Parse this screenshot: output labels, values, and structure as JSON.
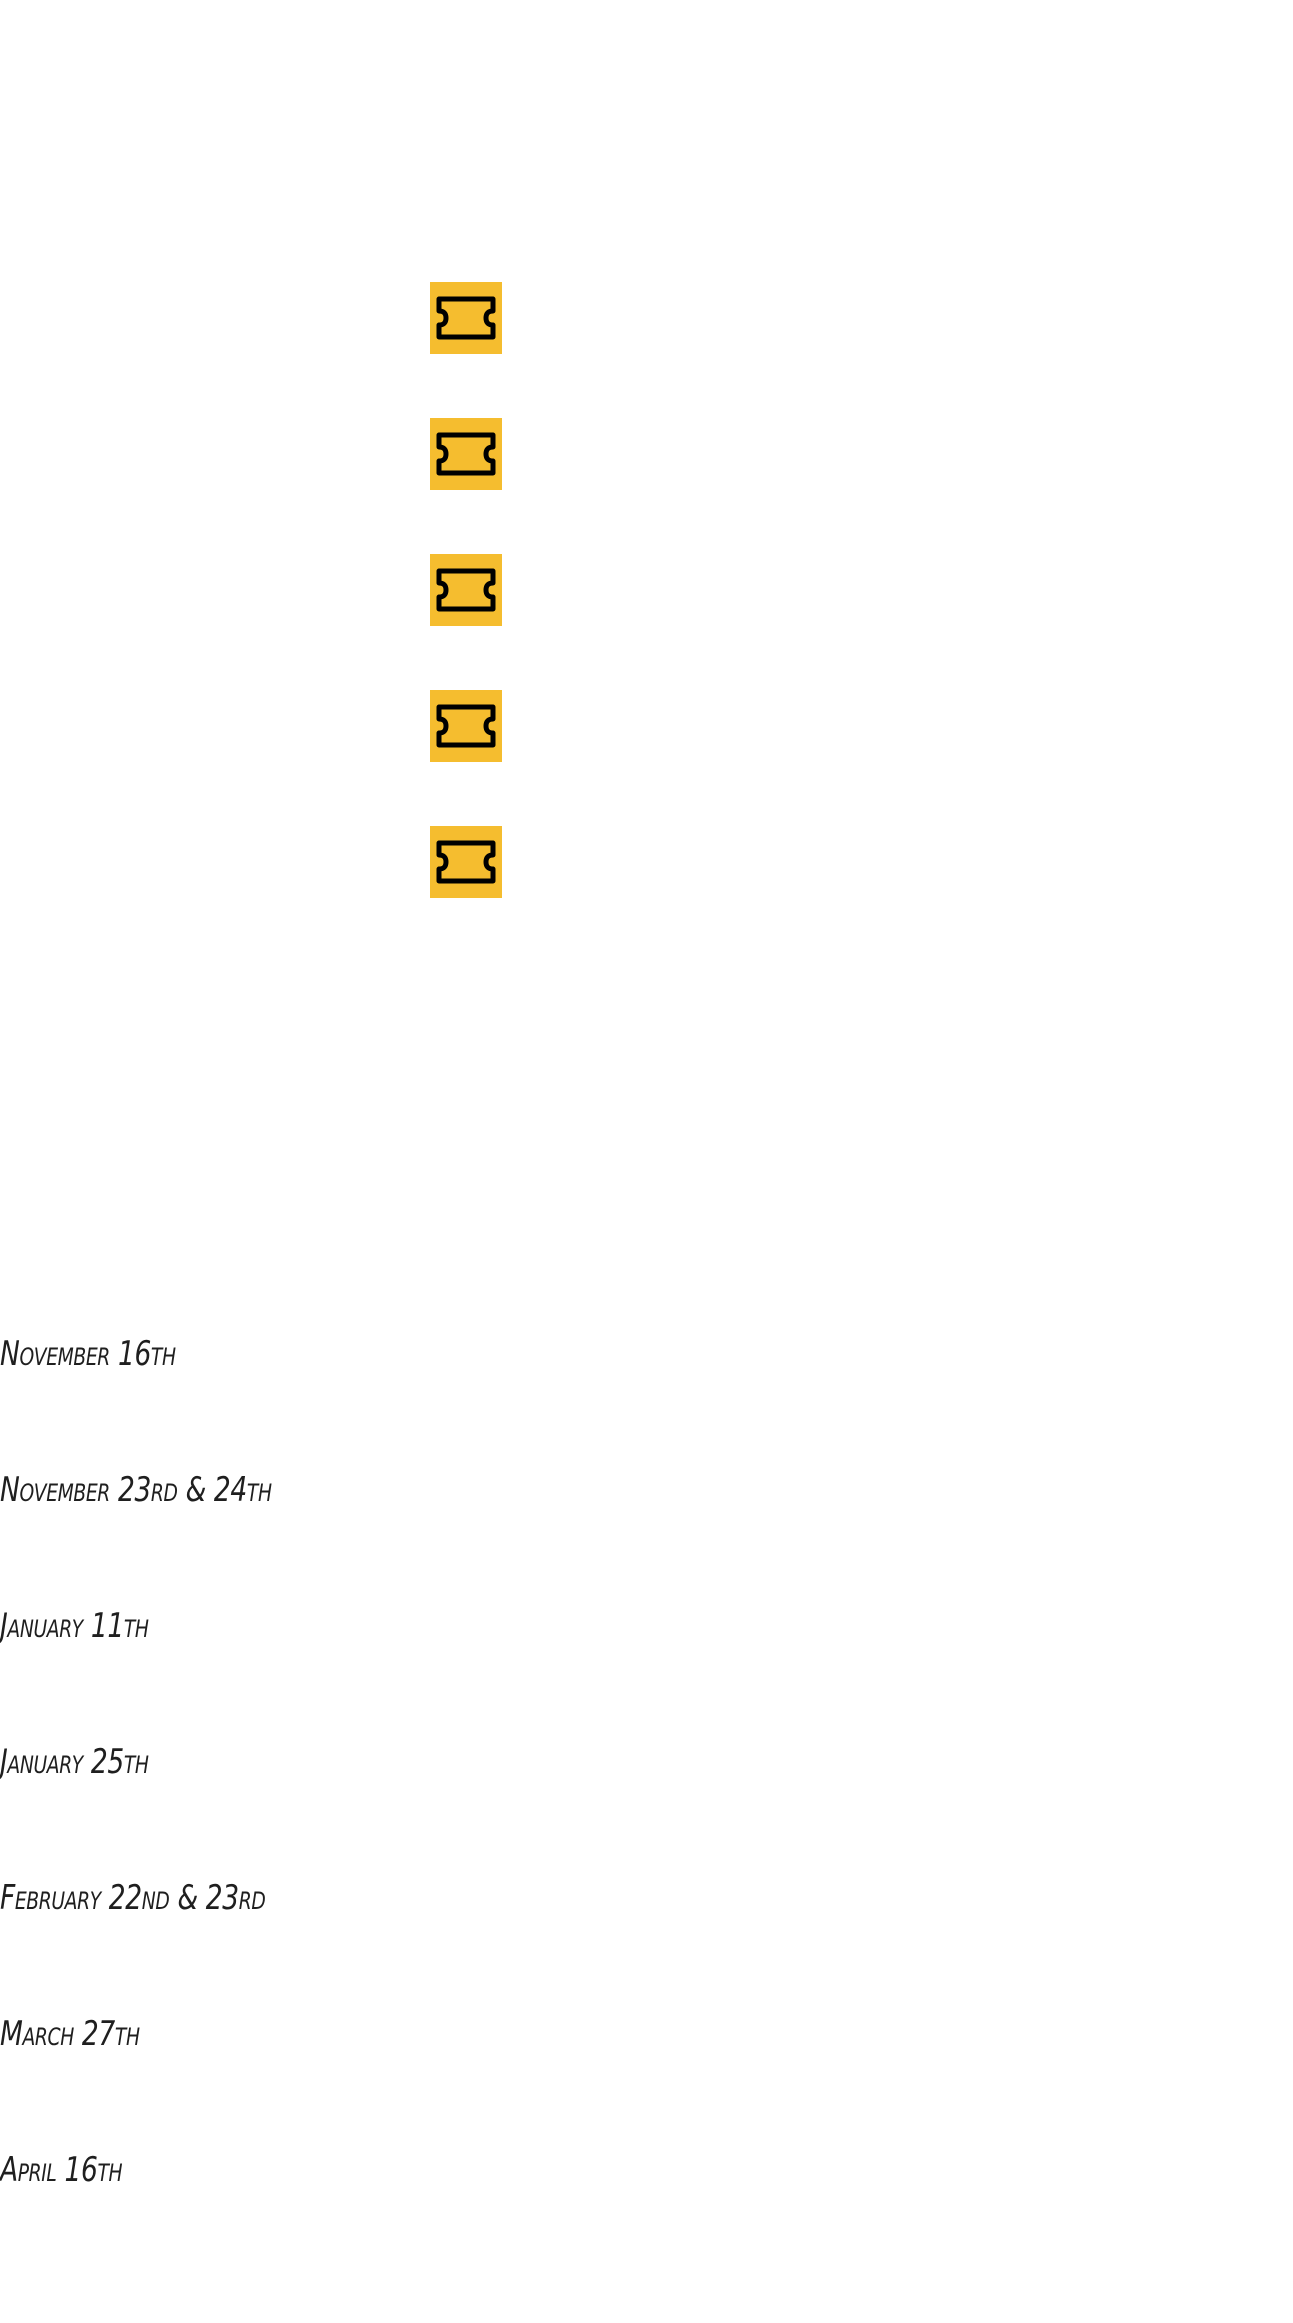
{
  "colors": {
    "ticket_background": "#F5BD2F",
    "ticket_stroke": "#000000",
    "page_background": "#FFFFFF",
    "date_text": "#1F1F1F"
  },
  "ticket_buttons": [
    {
      "icon": "ticket-icon"
    },
    {
      "icon": "ticket-icon"
    },
    {
      "icon": "ticket-icon"
    },
    {
      "icon": "ticket-icon"
    },
    {
      "icon": "ticket-icon"
    }
  ],
  "dates": [
    "November 16th",
    "November 23rd & 24th",
    "January 11th",
    "January 25th",
    "February 22nd & 23rd",
    "March 27th",
    "April 16th"
  ]
}
